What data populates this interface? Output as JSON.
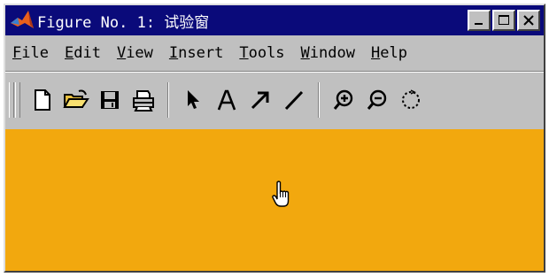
{
  "window": {
    "title": "Figure No. 1: 试验窗",
    "controls": {
      "minimize_icon": "minimize-icon",
      "maximize_icon": "maximize-icon",
      "close_icon": "close-icon"
    }
  },
  "menu": {
    "items": [
      "File",
      "Edit",
      "View",
      "Insert",
      "Tools",
      "Window",
      "Help"
    ]
  },
  "toolbar": {
    "tools": [
      "new-file-icon",
      "open-folder-icon",
      "save-icon",
      "print-icon",
      "select-arrow-icon",
      "text-icon",
      "arrow-icon",
      "line-icon",
      "zoom-in-icon",
      "zoom-out-icon",
      "rotate-icon"
    ]
  },
  "colors": {
    "titlebar": "#0a0a7a",
    "chrome": "#c0c0c0",
    "canvas": "#f2a80e"
  }
}
